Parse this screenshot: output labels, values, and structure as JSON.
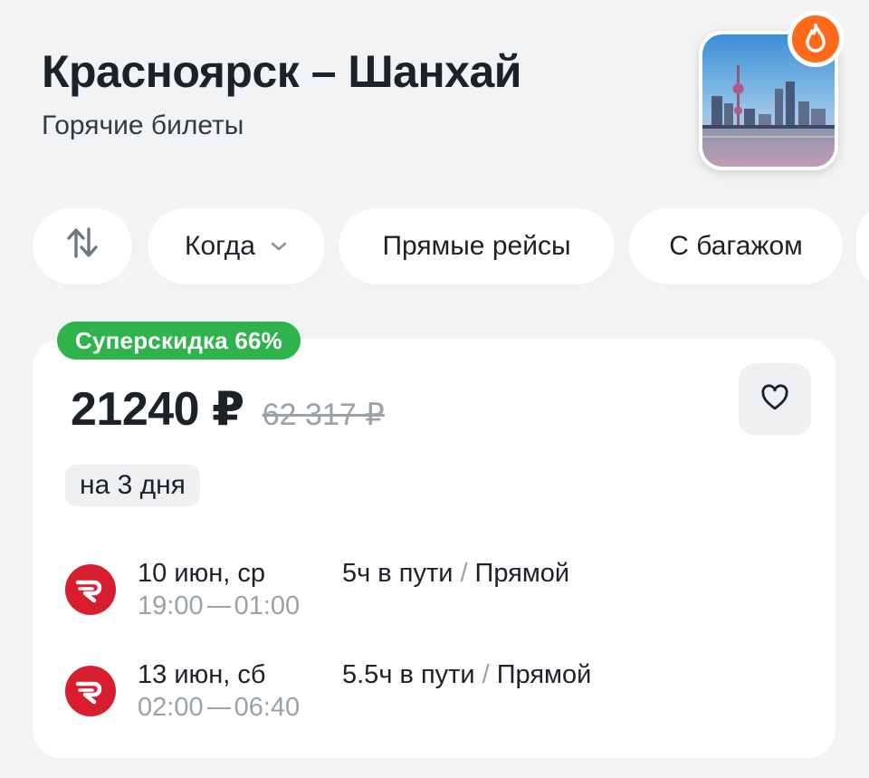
{
  "header": {
    "title": "Красноярск – Шанхай",
    "subtitle": "Горячие билеты"
  },
  "icons": {
    "city_photo": "shanghai-skyline-photo",
    "hot": "fire-icon",
    "swap": "swap-vertical-icon",
    "chevron": "chevron-down-icon",
    "favorite": "heart-icon",
    "airline": "airline-logo-r"
  },
  "filters": {
    "when": "Когда",
    "direct": "Прямые рейсы",
    "baggage": "С багажом"
  },
  "offer": {
    "promo": "Суперскидка 66%",
    "price": "21240 ₽",
    "old_price": "62 317 ₽",
    "duration": "на 3 дня",
    "segments": [
      {
        "date": "10 июн, ср",
        "depart": "19:00",
        "arrive": "01:00",
        "travel_time": "5ч в пути",
        "type": "Прямой"
      },
      {
        "date": "13 июн, сб",
        "depart": "02:00",
        "arrive": "06:40",
        "travel_time": "5.5ч в пути",
        "type": "Прямой"
      }
    ]
  },
  "colors": {
    "promo": "#2eb34d",
    "airline": "#d81e2c",
    "hot": "#ff6a1a",
    "background": "#f2f3f5"
  }
}
